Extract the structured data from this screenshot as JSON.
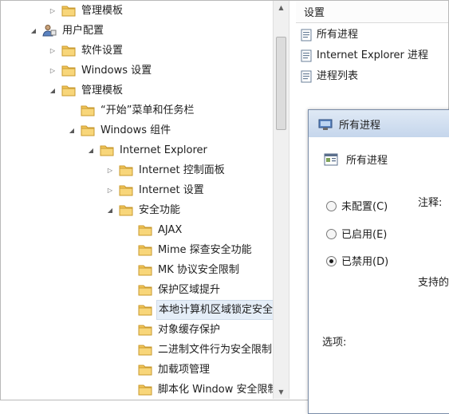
{
  "tree": [
    {
      "label": "管理模板",
      "level": 1,
      "expander": "collapsed",
      "icon": "folder-icon"
    },
    {
      "label": "用户配置",
      "level": 0,
      "expander": "expanded",
      "icon": "user-config-icon"
    },
    {
      "label": "软件设置",
      "level": 1,
      "expander": "collapsed",
      "icon": "folder-icon"
    },
    {
      "label": "Windows 设置",
      "level": 1,
      "expander": "collapsed",
      "icon": "folder-icon"
    },
    {
      "label": "管理模板",
      "level": 1,
      "expander": "expanded",
      "icon": "folder-icon"
    },
    {
      "label": "“开始”菜单和任务栏",
      "level": 2,
      "expander": "none",
      "icon": "folder-icon"
    },
    {
      "label": "Windows 组件",
      "level": 2,
      "expander": "expanded",
      "icon": "folder-icon"
    },
    {
      "label": "Internet Explorer",
      "level": 3,
      "expander": "expanded",
      "icon": "folder-icon"
    },
    {
      "label": "Internet 控制面板",
      "level": 4,
      "expander": "collapsed",
      "icon": "folder-icon"
    },
    {
      "label": "Internet 设置",
      "level": 4,
      "expander": "collapsed",
      "icon": "folder-icon"
    },
    {
      "label": "安全功能",
      "level": 4,
      "expander": "expanded",
      "icon": "folder-icon"
    },
    {
      "label": "AJAX",
      "level": 5,
      "expander": "none",
      "icon": "folder-icon"
    },
    {
      "label": "Mime 探查安全功能",
      "level": 5,
      "expander": "none",
      "icon": "folder-icon"
    },
    {
      "label": "MK 协议安全限制",
      "level": 5,
      "expander": "none",
      "icon": "folder-icon"
    },
    {
      "label": "保护区域提升",
      "level": 5,
      "expander": "none",
      "icon": "folder-icon"
    },
    {
      "label": "本地计算机区域锁定安全",
      "level": 5,
      "expander": "none",
      "icon": "folder-icon",
      "selected": true
    },
    {
      "label": "对象缓存保护",
      "level": 5,
      "expander": "none",
      "icon": "folder-icon"
    },
    {
      "label": "二进制文件行为安全限制",
      "level": 5,
      "expander": "none",
      "icon": "folder-icon"
    },
    {
      "label": "加载项管理",
      "level": 5,
      "expander": "none",
      "icon": "folder-icon"
    },
    {
      "label": "脚本化 Window 安全限制",
      "level": 5,
      "expander": "none",
      "icon": "folder-icon"
    }
  ],
  "right": {
    "header": "设置",
    "items": [
      "所有进程",
      "Internet Explorer 进程",
      "进程列表"
    ]
  },
  "dialog": {
    "title": "所有进程",
    "heading": "所有进程",
    "options": [
      {
        "label": "未配置(C)",
        "checked": false
      },
      {
        "label": "已启用(E)",
        "checked": false
      },
      {
        "label": "已禁用(D)",
        "checked": true
      }
    ],
    "comment_label": "注释:",
    "supported_label": "支持的",
    "options_label": "选项:"
  },
  "colors": {
    "folder": "#f3c65a",
    "selection": "#e5eef8",
    "title_bar": "#c5d6ec"
  }
}
